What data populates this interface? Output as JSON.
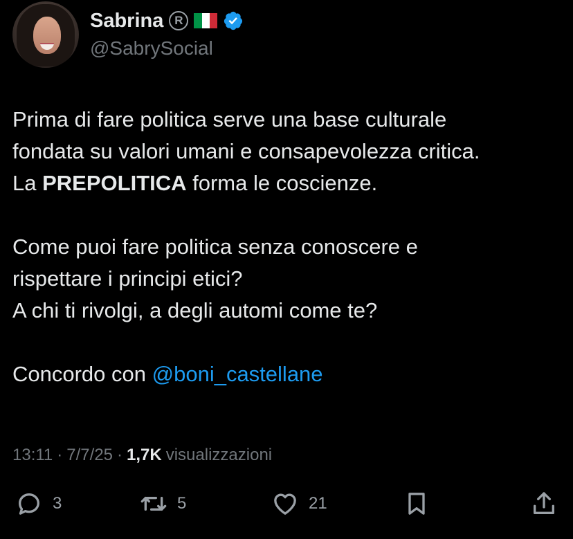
{
  "author": {
    "name": "Sabrina",
    "registered_symbol": "R",
    "handle": "@SabrySocial",
    "flag": "italy-flag-icon",
    "verified": "verified-badge-icon"
  },
  "tweet": {
    "p1_line1": "Prima di fare politica serve una base culturale",
    "p1_line2": "fondata su valori umani e consapevolezza critica.",
    "p1_line3_pre": "La ",
    "p1_line3_bold": "PREPOLITICA",
    "p1_line3_post": " forma le coscienze.",
    "p2_line1": "Come puoi fare politica senza conoscere e",
    "p2_line2": "rispettare i principi etici?",
    "p2_line3": "A chi ti rivolgi, a degli automi come te?",
    "p3_pre": "Concordo con ",
    "p3_mention": "@boni_castellane"
  },
  "meta": {
    "time": "13:11",
    "sep1": "·",
    "date": "7/7/25",
    "sep2": "·",
    "views_count": "1,7K",
    "views_label": "visualizzazioni"
  },
  "actions": {
    "replies": "3",
    "reposts": "5",
    "likes": "21"
  },
  "colors": {
    "background": "#000000",
    "text": "#e7e9ea",
    "secondary": "#71767b",
    "accent": "#1d9bf0"
  }
}
